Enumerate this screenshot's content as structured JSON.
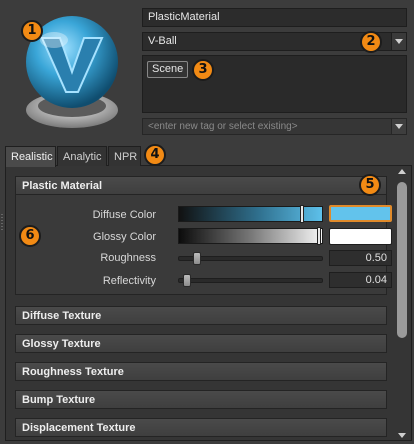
{
  "material": {
    "name": "PlasticMaterial",
    "scene_select": "V-Ball",
    "tags": [
      "Scene"
    ],
    "tag_placeholder": "<enter new tag or select existing>"
  },
  "tabs": [
    {
      "label": "Realistic",
      "active": true
    },
    {
      "label": "Analytic",
      "active": false
    },
    {
      "label": "NPR",
      "active": false
    }
  ],
  "section": {
    "title": "Plastic Material",
    "properties": {
      "diffuse": {
        "label": "Diffuse Color",
        "color": "#62c3ec",
        "marker_position": 0.86
      },
      "glossy": {
        "label": "Glossy Color",
        "color": "#ffffff",
        "marker_position": 0.98
      },
      "roughness": {
        "label": "Roughness",
        "value": "0.50",
        "slider_position": 0.1
      },
      "reflectivity": {
        "label": "Reflectivity",
        "value": "0.04",
        "slider_position": 0.03
      }
    }
  },
  "collapsed_sections": [
    "Diffuse Texture",
    "Glossy Texture",
    "Roughness Texture",
    "Bump Texture",
    "Displacement Texture"
  ],
  "callouts": [
    "1",
    "2",
    "3",
    "4",
    "5",
    "6"
  ],
  "colors": {
    "accent": "#f28a14",
    "background": "#3c3c3c",
    "diffuse_swatch": "#62c3ec",
    "selection_border": "#e08a2a"
  }
}
